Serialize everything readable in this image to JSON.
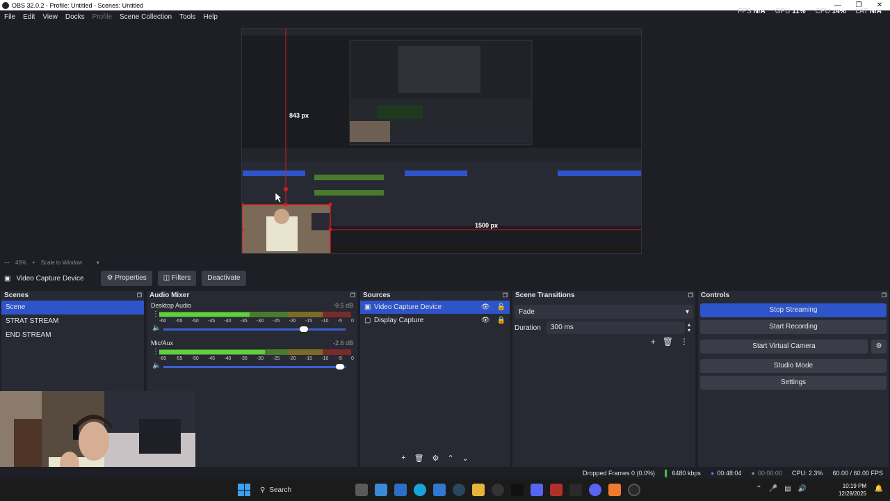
{
  "window": {
    "title": "OBS 32.0.2 - Profile: Untitled - Scenes: Untitled"
  },
  "menu": [
    "File",
    "Edit",
    "View",
    "Docks",
    "Profile",
    "Scene Collection",
    "Tools",
    "Help"
  ],
  "stats": {
    "fps_label": "FPS",
    "fps": "N/A",
    "gpu_label": "GPU",
    "gpu": "11%",
    "cpu_label": "CPU",
    "cpu": "14%",
    "lat_label": "LAT",
    "lat": "N/A"
  },
  "preview": {
    "measure_vertical": "843 px",
    "measure_horizontal": "1500 px",
    "zoom": "45%",
    "scale_mode": "Scale to Window"
  },
  "source_toolbar": {
    "source_name": "Video Capture Device",
    "properties": "Properties",
    "filters": "Filters",
    "deactivate": "Deactivate"
  },
  "scenes": {
    "title": "Scenes",
    "items": [
      "Scene",
      "STRAT STREAM",
      "END STREAM"
    ]
  },
  "mixer": {
    "title": "Audio Mixer",
    "ticks": [
      "-60",
      "-55",
      "-50",
      "-45",
      "-40",
      "-35",
      "-30",
      "-25",
      "-20",
      "-15",
      "-10",
      "-5",
      "0"
    ],
    "channels": [
      {
        "name": "Desktop Audio",
        "db": "-9.5 dB",
        "level": 0.47,
        "volume": 0.77
      },
      {
        "name": "Mic/Aux",
        "db": "-2.6 dB",
        "level": 0.55,
        "volume": 0.97
      }
    ]
  },
  "sources": {
    "title": "Sources",
    "items": [
      "Video Capture Device",
      "Display Capture"
    ]
  },
  "transitions": {
    "title": "Scene Transitions",
    "type": "Fade",
    "duration_label": "Duration",
    "duration": "300 ms"
  },
  "controls": {
    "title": "Controls",
    "buttons": [
      "Stop Streaming",
      "Start Recording",
      "Start Virtual Camera",
      "Studio Mode",
      "Settings"
    ]
  },
  "status": {
    "dropped": "Dropped Frames 0 (0.0%)",
    "bitrate": "6480 kbps",
    "stream_time": "00:48:04",
    "rec_time": "00:00:00",
    "cpu": "CPU: 2.3%",
    "fps": "60.00 / 60.00 FPS"
  },
  "taskbar": {
    "search": "Search",
    "time": "10:19 PM",
    "date": "12/28/2025"
  },
  "colors": {
    "accent": "#2e54c9",
    "panel": "#272a33",
    "background": "#1e1f26",
    "guide": "#e01818"
  }
}
